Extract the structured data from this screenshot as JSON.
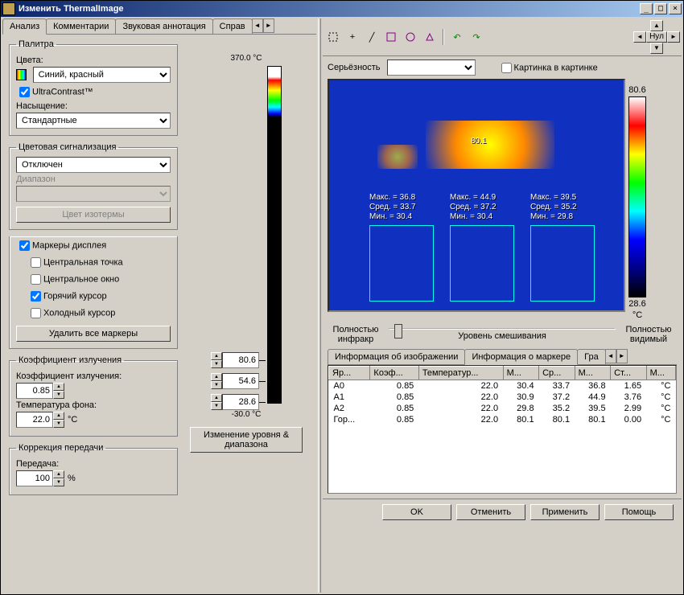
{
  "window": {
    "title": "Изменить ThermalImage"
  },
  "tabs_left": [
    "Анализ",
    "Комментарии",
    "Звуковая аннотация",
    "Справ"
  ],
  "palette": {
    "legend": "Палитра",
    "colors_label": "Цвета:",
    "colors_value": "Синий, красный",
    "ultracontrast": "UltraContrast™",
    "saturation_label": "Насыщение:",
    "saturation_value": "Стандартные"
  },
  "color_alarm": {
    "legend": "Цветовая сигнализация",
    "mode": "Отключен",
    "range_label": "Диапазон",
    "isotherm_btn": "Цвет изотермы"
  },
  "markers": {
    "legend": "Маркеры дисплея",
    "center_point": "Центральная точка",
    "center_window": "Центральное окно",
    "hot_cursor": "Горячий курсор",
    "cold_cursor": "Холодный курсор",
    "delete_all": "Удалить все маркеры"
  },
  "emissivity": {
    "legend": "Коэффициент излучения",
    "coeff_label": "Коэффициент излучения:",
    "coeff_value": "0.85",
    "bg_label": "Температура фона:",
    "bg_value": "22.0",
    "bg_unit": "°C"
  },
  "transmit": {
    "legend": "Коррекция передачи",
    "label": "Передача:",
    "value": "100",
    "unit": "%"
  },
  "scale": {
    "top": "370.0 °C",
    "bottom": "-30.0 °C",
    "spin1": "80.6",
    "spin2": "54.6",
    "spin3": "28.6",
    "button": "Изменение уровня & диапазона"
  },
  "toolbar": {
    "severity_label": "Серьёзность",
    "pip_label": "Картинка в картинке",
    "nul": "Нул"
  },
  "colorbar": {
    "top": "80.6",
    "bottom": "28.6",
    "unit": "°C"
  },
  "image_overlay": {
    "center": "80.1",
    "roi_stats": [
      {
        "max": "Макс. = 36.8",
        "avg": "Сред. = 33.7",
        "min": "Мин. = 30.4"
      },
      {
        "max": "Макс. = 44.9",
        "avg": "Сред. = 37.2",
        "min": "Мин. = 30.4"
      },
      {
        "max": "Макс. = 39.5",
        "avg": "Сред. = 35.2",
        "min": "Мин. = 29.8"
      }
    ]
  },
  "slider": {
    "left": "Полностью инфракр",
    "center": "Уровень смешивания",
    "right": "Полностью видимый"
  },
  "info_tabs": [
    "Информация об изображении",
    "Информация о маркере",
    "Гра"
  ],
  "table": {
    "headers": [
      "Яр...",
      "Коэф...",
      "Температур...",
      "М...",
      "Ср...",
      "М...",
      "Ст...",
      "М..."
    ],
    "rows": [
      [
        "A0",
        "0.85",
        "22.0",
        "30.4",
        "33.7",
        "36.8",
        "1.65",
        "°C"
      ],
      [
        "A1",
        "0.85",
        "22.0",
        "30.9",
        "37.2",
        "44.9",
        "3.76",
        "°C"
      ],
      [
        "A2",
        "0.85",
        "22.0",
        "29.8",
        "35.2",
        "39.5",
        "2.99",
        "°C"
      ],
      [
        "Гор...",
        "0.85",
        "22.0",
        "80.1",
        "80.1",
        "80.1",
        "0.00",
        "°C"
      ]
    ]
  },
  "footer": {
    "ok": "OK",
    "cancel": "Отменить",
    "apply": "Применить",
    "help": "Помощь"
  }
}
